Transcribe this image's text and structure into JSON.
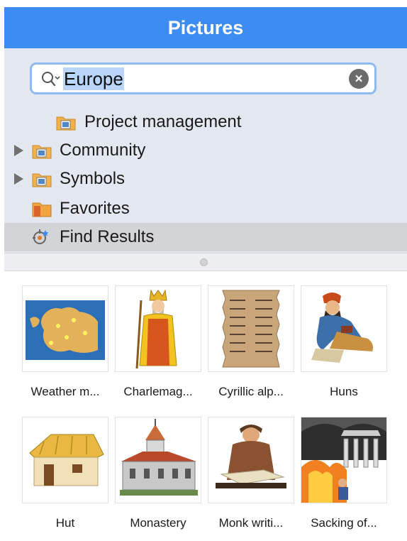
{
  "window": {
    "title": "Pictures"
  },
  "search": {
    "value": "Europe",
    "clear_label": "×"
  },
  "tree": {
    "items": [
      {
        "label": "Project management",
        "icon": "picture-folder-icon",
        "expandable": false,
        "selected": false
      },
      {
        "label": "Community",
        "icon": "picture-folder-icon",
        "expandable": true,
        "selected": false
      },
      {
        "label": "Symbols",
        "icon": "picture-folder-icon",
        "expandable": true,
        "selected": false
      },
      {
        "label": "Favorites",
        "icon": "favorites-folder-icon",
        "expandable": false,
        "selected": false
      },
      {
        "label": "Find Results",
        "icon": "find-results-icon",
        "expandable": false,
        "selected": true
      }
    ]
  },
  "pictures": [
    {
      "caption": "Weather m...",
      "icon": "europe-weather-map-picture"
    },
    {
      "caption": "Charlemag...",
      "icon": "charlemagne-picture"
    },
    {
      "caption": "Cyrillic alp...",
      "icon": "cyrillic-alphabet-scroll-picture"
    },
    {
      "caption": "Huns",
      "icon": "huns-picture"
    },
    {
      "caption": "Hut",
      "icon": "hut-picture"
    },
    {
      "caption": "Monastery",
      "icon": "monastery-picture"
    },
    {
      "caption": "Monk writi...",
      "icon": "monk-writing-picture"
    },
    {
      "caption": "Sacking of...",
      "icon": "sacking-of-rome-picture"
    }
  ],
  "colors": {
    "titlebar": "#3d8cf1",
    "sidebar_bg": "#e3e8f0",
    "selection": "#d3d4d7",
    "search_focus": "#8fbaf0"
  }
}
